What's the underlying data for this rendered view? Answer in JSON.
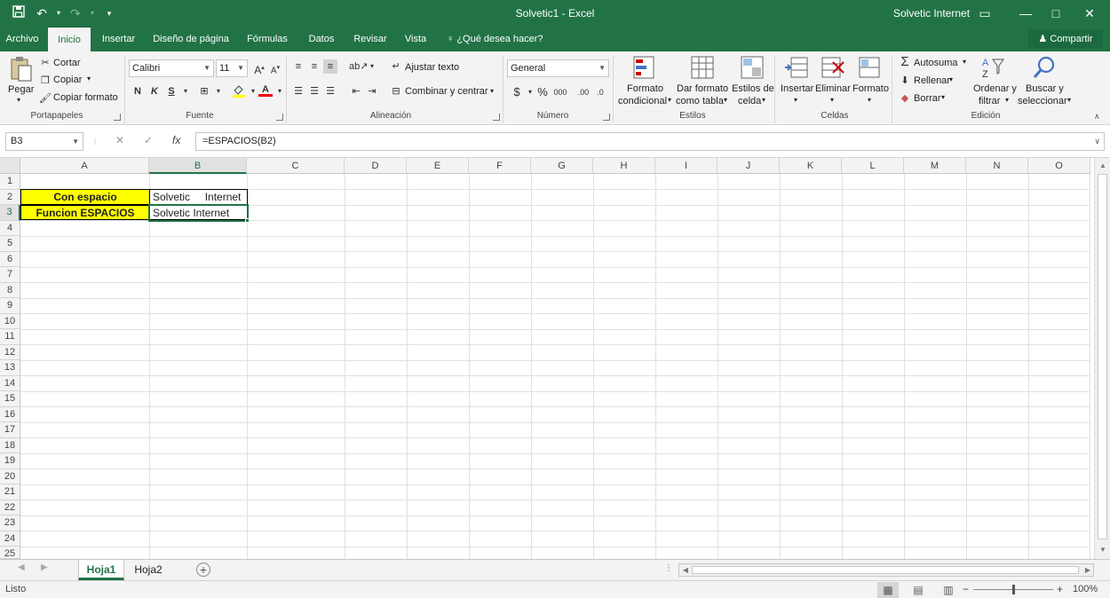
{
  "window": {
    "title": "Solvetic1  -  Excel",
    "user": "Solvetic Internet",
    "qat": {
      "save_icon": "save-icon",
      "undo_icon": "undo-icon",
      "redo_icon": "redo-icon",
      "customize_icon": "customize-qat-icon"
    },
    "minimize": "—",
    "restore": "□",
    "close": "✕",
    "ribbon_display": "▭"
  },
  "tabs": [
    "Archivo",
    "Inicio",
    "Insertar",
    "Diseño de página",
    "Fórmulas",
    "Datos",
    "Revisar",
    "Vista"
  ],
  "active_tab": "Inicio",
  "tell_me": "¿Qué desea hacer?",
  "share": "Compartir",
  "ribbon": {
    "portapapeles": {
      "label": "Portapapeles",
      "paste": "Pegar",
      "cut": "Cortar",
      "copy": "Copiar",
      "format_painter": "Copiar formato"
    },
    "fuente": {
      "label": "Fuente",
      "font_name": "Calibri",
      "font_size": "11",
      "bold": "N",
      "italic": "K",
      "underline": "S"
    },
    "alineacion": {
      "label": "Alineación",
      "wrap": "Ajustar texto",
      "merge": "Combinar y centrar"
    },
    "numero": {
      "label": "Número",
      "format": "General",
      "currency": "$",
      "percent": "%",
      "thousands": "000"
    },
    "estilos": {
      "label": "Estilos",
      "conditional_1": "Formato",
      "conditional_2": "condicional",
      "table_1": "Dar formato",
      "table_2": "como tabla",
      "cell_1": "Estilos de",
      "cell_2": "celda"
    },
    "celdas": {
      "label": "Celdas",
      "insert": "Insertar",
      "delete": "Eliminar",
      "format": "Formato"
    },
    "edicion": {
      "label": "Edición",
      "autosum": "Autosuma",
      "fill": "Rellenar",
      "clear": "Borrar",
      "sort_1": "Ordenar y",
      "sort_2": "filtrar",
      "find_1": "Buscar y",
      "find_2": "seleccionar"
    }
  },
  "formula_bar": {
    "name_box": "B3",
    "formula": "=ESPACIOS(B2)",
    "cancel": "✕",
    "enter": "✓",
    "fx": "fx"
  },
  "columns": [
    "A",
    "B",
    "C",
    "D",
    "E",
    "F",
    "G",
    "H",
    "I",
    "J",
    "K",
    "L",
    "M",
    "N",
    "O"
  ],
  "selected_column": "B",
  "rows": [
    "1",
    "2",
    "3",
    "4",
    "5",
    "6",
    "7",
    "8",
    "9",
    "10",
    "11",
    "12",
    "13",
    "14",
    "15",
    "16",
    "17",
    "18",
    "19",
    "20",
    "21",
    "22",
    "23",
    "24",
    "25"
  ],
  "selected_row": "3",
  "cells": {
    "A2": "Con espacio",
    "B2": "Solvetic     Internet",
    "A3": "Funcion ESPACIOS",
    "B3": "Solvetic Internet"
  },
  "sheets": [
    "Hoja1",
    "Hoja2"
  ],
  "active_sheet": "Hoja1",
  "status": "Listo",
  "zoom": "100%",
  "colors": {
    "accent": "#217346",
    "highlight": "#ffff00"
  }
}
